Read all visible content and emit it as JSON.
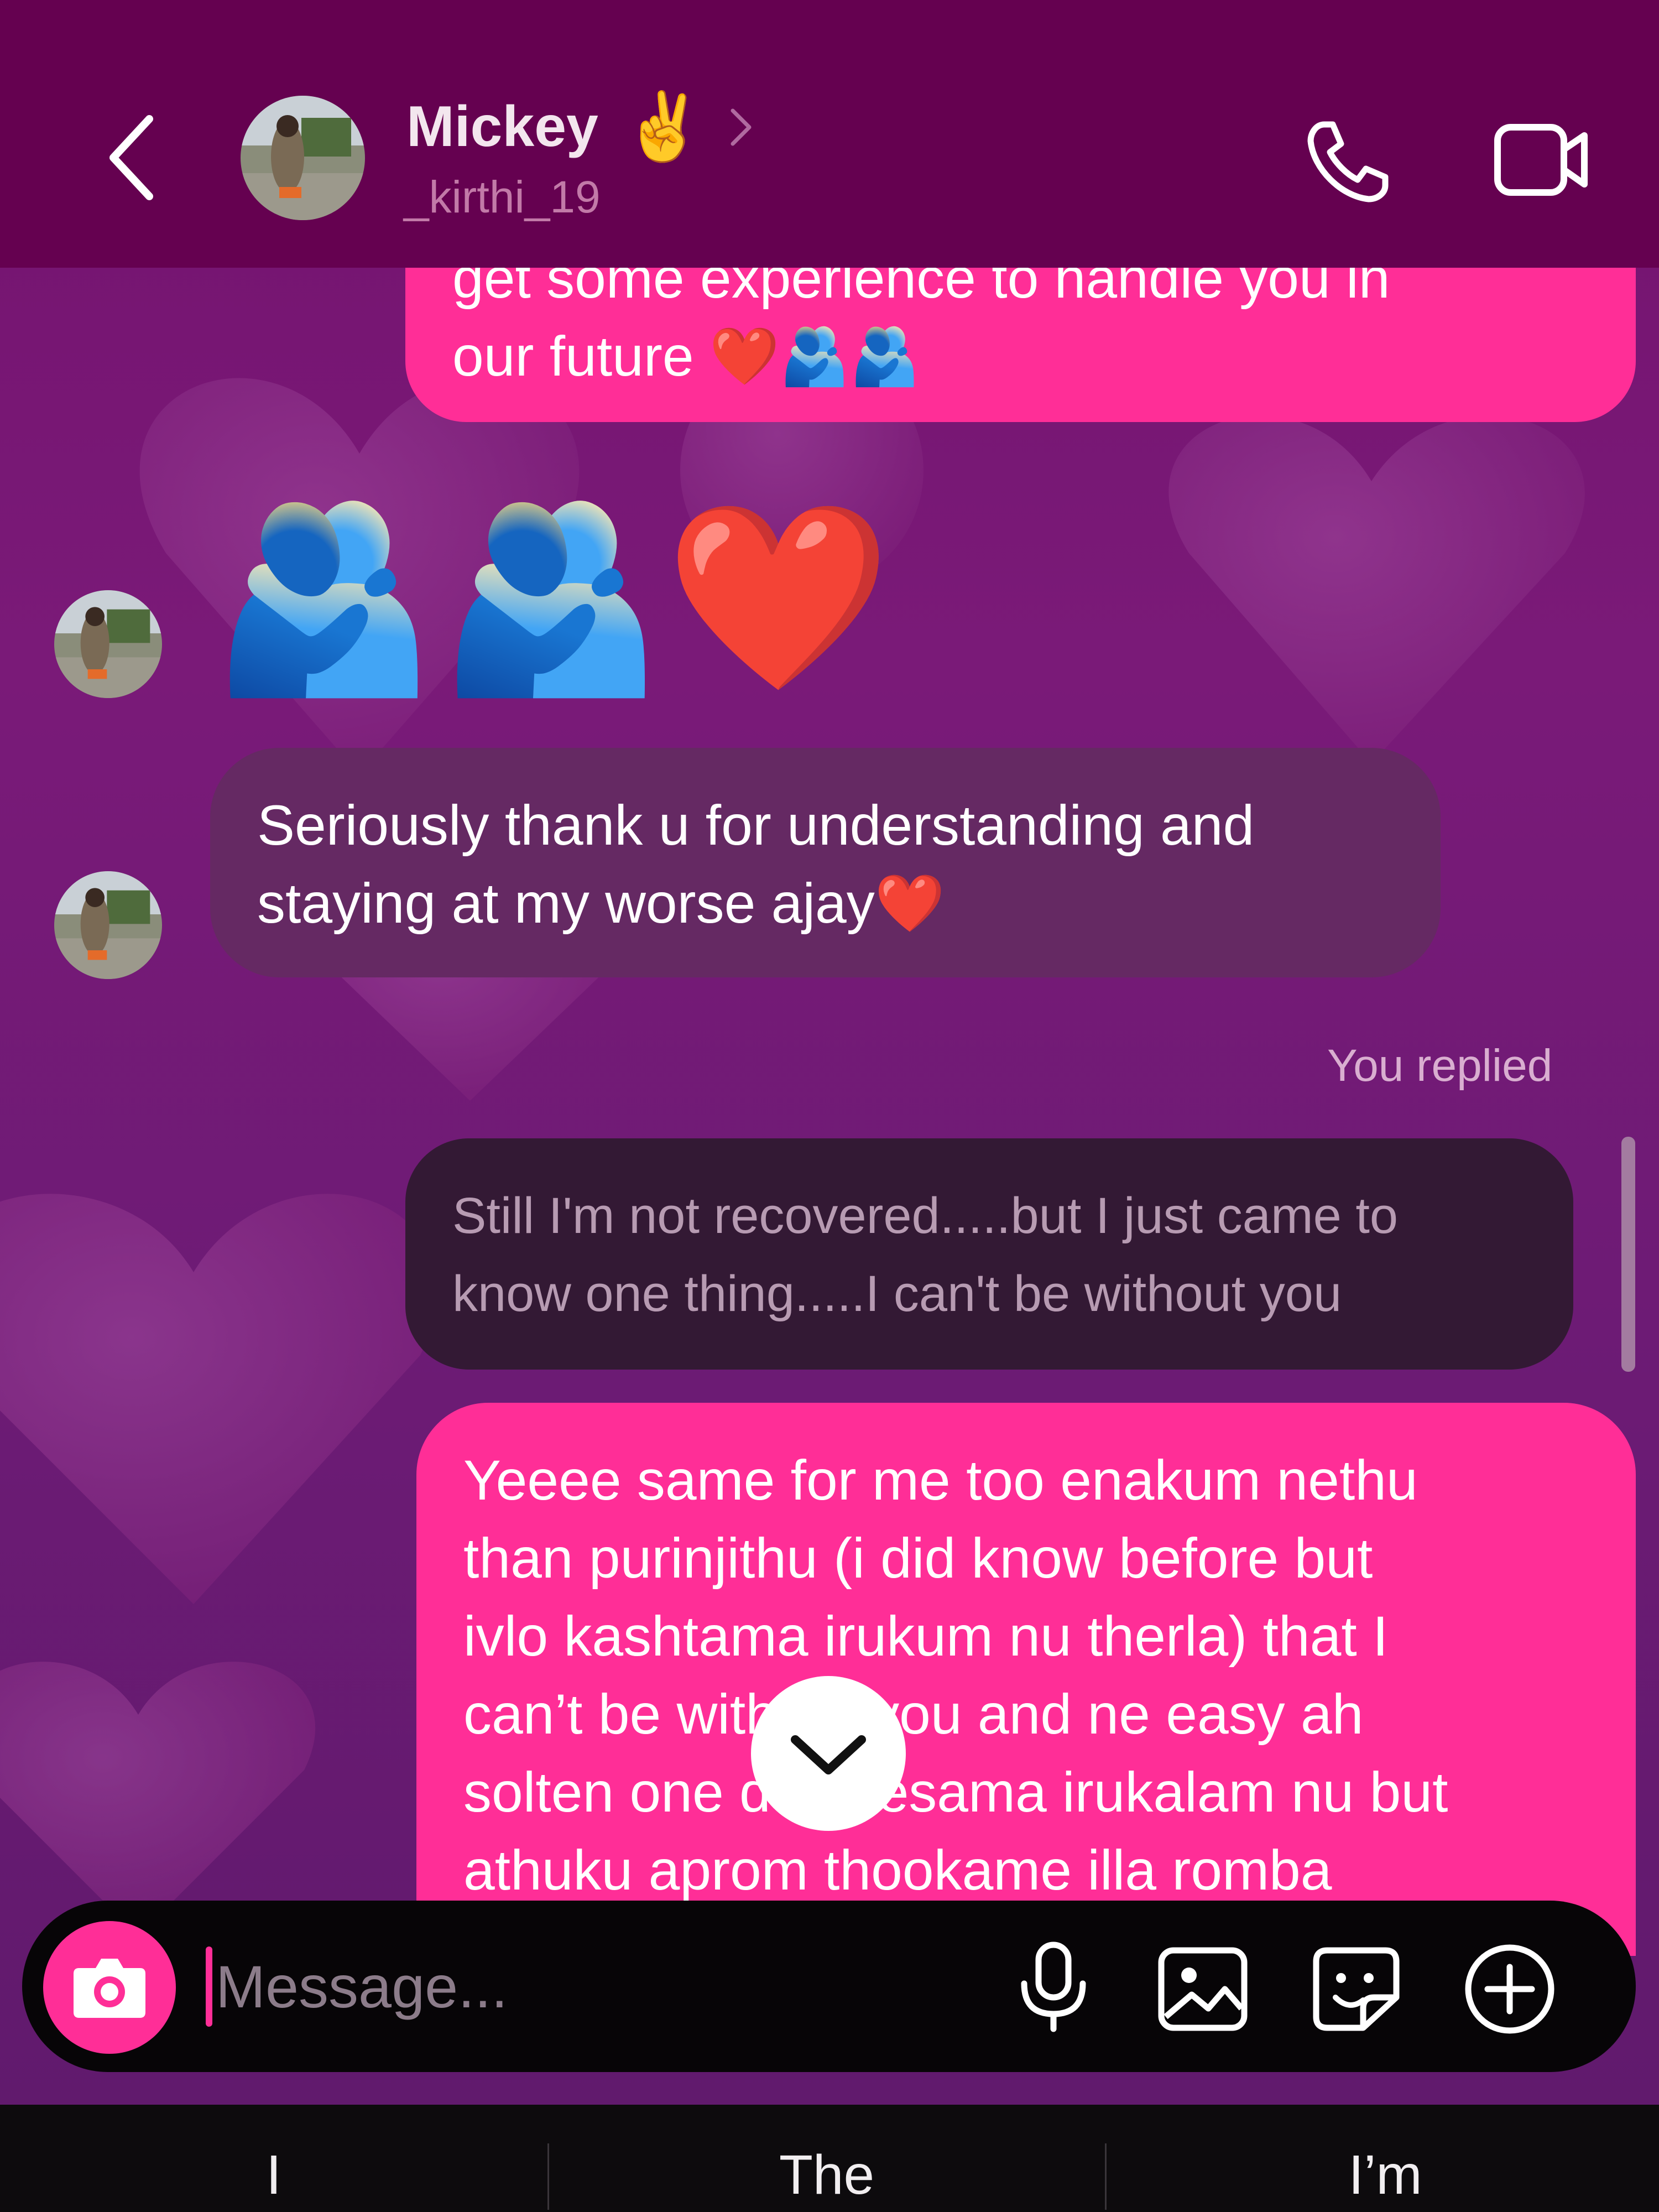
{
  "header": {
    "contact_name": "Mickey",
    "contact_emoji": "✌️",
    "username": "_kirthi_19",
    "icons": [
      "back-icon",
      "chevron-right-icon",
      "phone-icon",
      "video-camera-icon"
    ]
  },
  "messages": [
    {
      "id": "m1",
      "from": "me",
      "lines": [
        "get some experience to handle you in",
        "our future ❤️🫂🫂"
      ]
    },
    {
      "id": "m2",
      "from": "them",
      "emoji_only": "🫂🫂❤️"
    },
    {
      "id": "m3",
      "from": "them",
      "lines": [
        "Seriously thank u for understanding and",
        "staying at my worse ajay❤️"
      ]
    },
    {
      "id": "m4",
      "from": "me",
      "reply_label": "You replied",
      "quoted_lines": [
        "Still I'm not recovered.....but I just came to",
        "know one thing.....I can't be without you"
      ]
    },
    {
      "id": "m5",
      "from": "me",
      "lines": [
        "Yeeee same for me too enakum nethu",
        "than purinjithu (i did know before but",
        "ivlo kashtama irukum nu therla) that I",
        "can’t be without you and ne easy ah",
        "solten one day pesama irukalam nu but",
        "athuku aprom thookame illa romba"
      ]
    }
  ],
  "composer": {
    "placeholder": "Message...",
    "value": "",
    "icons": [
      "camera-icon",
      "microphone-icon",
      "gallery-icon",
      "sticker-icon",
      "plus-circle-icon"
    ]
  },
  "keyboard": {
    "suggestions": [
      "I",
      "The",
      "I’m"
    ]
  },
  "colors": {
    "header_bg": "#650150",
    "own_bubble": "#ff2e97",
    "other_bubble": "#652963",
    "quoted_bubble": "#331934",
    "composer_bg": "#070507"
  }
}
